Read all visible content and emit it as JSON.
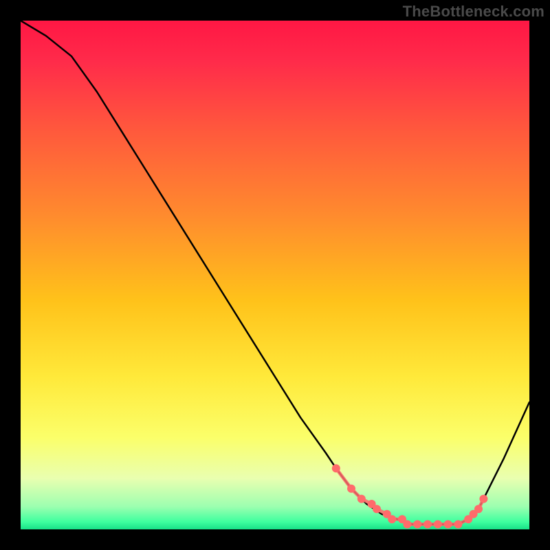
{
  "watermark": "TheBottleneck.com",
  "chart_data": {
    "type": "line",
    "title": "",
    "xlabel": "",
    "ylabel": "",
    "xlim": [
      0,
      100
    ],
    "ylim": [
      0,
      100
    ],
    "grid": false,
    "legend": false,
    "gradient_stops": [
      {
        "offset": 0.0,
        "color": "#ff1744"
      },
      {
        "offset": 0.08,
        "color": "#ff2b4a"
      },
      {
        "offset": 0.22,
        "color": "#ff5a3c"
      },
      {
        "offset": 0.38,
        "color": "#ff8a2e"
      },
      {
        "offset": 0.55,
        "color": "#ffc21a"
      },
      {
        "offset": 0.7,
        "color": "#ffe93a"
      },
      {
        "offset": 0.82,
        "color": "#fbff6a"
      },
      {
        "offset": 0.9,
        "color": "#e9ffb0"
      },
      {
        "offset": 0.955,
        "color": "#9dffb0"
      },
      {
        "offset": 0.985,
        "color": "#3fff9f"
      },
      {
        "offset": 1.0,
        "color": "#18e088"
      }
    ],
    "series": [
      {
        "name": "bottleneck-curve",
        "color": "#000000",
        "x": [
          0,
          5,
          10,
          15,
          20,
          25,
          30,
          35,
          40,
          45,
          50,
          55,
          60,
          62,
          65,
          68,
          71,
          74,
          77,
          80,
          83,
          86,
          88,
          90,
          92,
          95,
          100
        ],
        "y": [
          100,
          97,
          93,
          86,
          78,
          70,
          62,
          54,
          46,
          38,
          30,
          22,
          15,
          12,
          8,
          5,
          3,
          2,
          1,
          1,
          1,
          1,
          2,
          4,
          8,
          14,
          25
        ]
      }
    ],
    "markers": {
      "name": "highlight-range",
      "color": "#ff6b6b",
      "radius": 6,
      "x": [
        62,
        65,
        67,
        69,
        70,
        72,
        73,
        75,
        76,
        78,
        80,
        82,
        84,
        86,
        88,
        89,
        90,
        91
      ],
      "y": [
        12,
        8,
        6,
        5,
        4,
        3,
        2,
        2,
        1,
        1,
        1,
        1,
        1,
        1,
        2,
        3,
        4,
        6
      ]
    }
  }
}
